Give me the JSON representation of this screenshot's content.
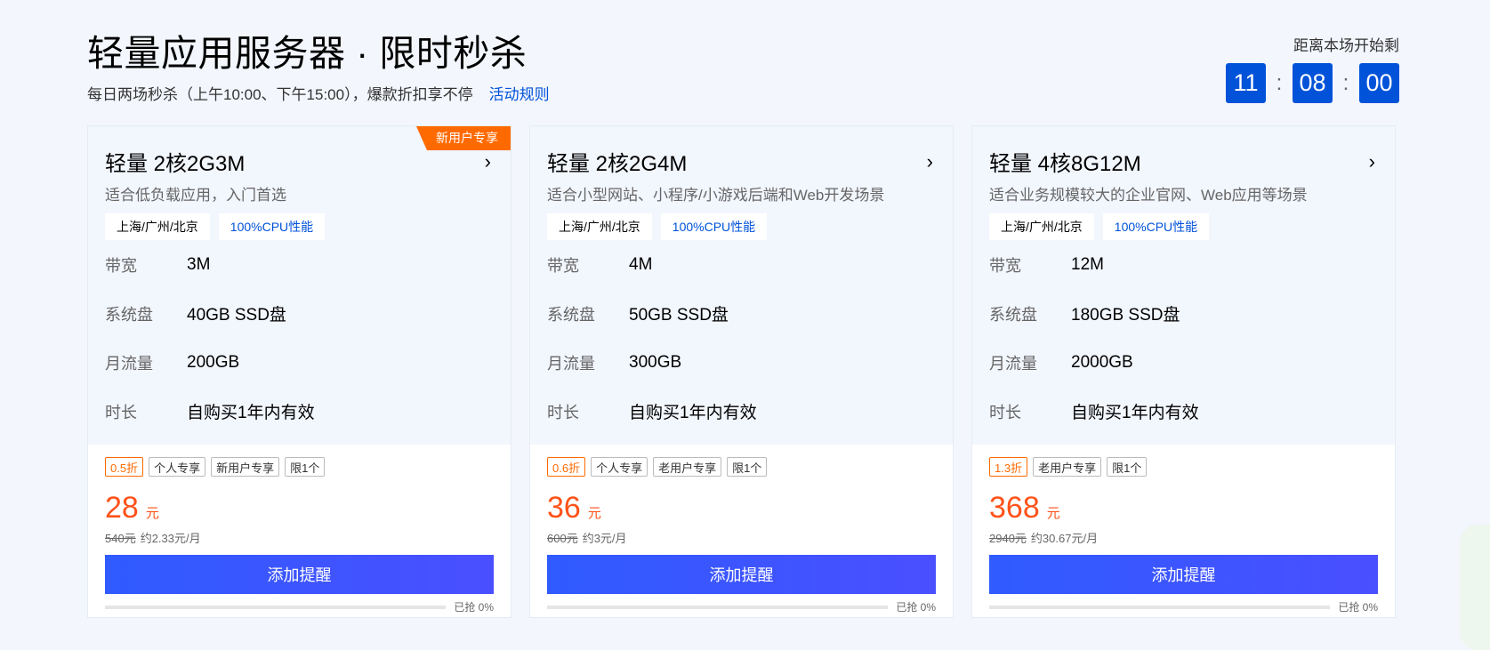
{
  "header": {
    "title": "轻量应用服务器 · 限时秒杀",
    "subtitle": "每日两场秒杀（上午10:00、下午15:00），爆款折扣享不停",
    "rules_link": "活动规则"
  },
  "countdown": {
    "label": "距离本场开始剩",
    "hours": "11",
    "minutes": "08",
    "seconds": "00",
    "separator": ":"
  },
  "cards": [
    {
      "ribbon": "新用户专享",
      "title": "轻量 2核2G3M",
      "chevron": "›",
      "desc": "适合低负载应用，入门首选",
      "tags": [
        "上海/广州/北京",
        "100%CPU性能"
      ],
      "specs": [
        {
          "label": "带宽",
          "value": "3M"
        },
        {
          "label": "系统盘",
          "value": "40GB SSD盘"
        },
        {
          "label": "月流量",
          "value": "200GB"
        },
        {
          "label": "时长",
          "value": "自购买1年内有效"
        }
      ],
      "badges": [
        "0.5折",
        "个人专享",
        "新用户专享",
        "限1个"
      ],
      "price": "28",
      "unit": "元",
      "original": "540元",
      "monthly": "约2.33元/月",
      "button": "添加提醒",
      "progress_fraction": 0,
      "progress_text": "已抢 0%"
    },
    {
      "ribbon": "",
      "title": "轻量 2核2G4M",
      "chevron": "›",
      "desc": "适合小型网站、小程序/小游戏后端和Web开发场景",
      "tags": [
        "上海/广州/北京",
        "100%CPU性能"
      ],
      "specs": [
        {
          "label": "带宽",
          "value": "4M"
        },
        {
          "label": "系统盘",
          "value": "50GB SSD盘"
        },
        {
          "label": "月流量",
          "value": "300GB"
        },
        {
          "label": "时长",
          "value": "自购买1年内有效"
        }
      ],
      "badges": [
        "0.6折",
        "个人专享",
        "老用户专享",
        "限1个"
      ],
      "price": "36",
      "unit": "元",
      "original": "600元",
      "monthly": "约3元/月",
      "button": "添加提醒",
      "progress_fraction": 0,
      "progress_text": "已抢 0%"
    },
    {
      "ribbon": "",
      "title": "轻量 4核8G12M",
      "chevron": "›",
      "desc": "适合业务规模较大的企业官网、Web应用等场景",
      "tags": [
        "上海/广州/北京",
        "100%CPU性能"
      ],
      "specs": [
        {
          "label": "带宽",
          "value": "12M"
        },
        {
          "label": "系统盘",
          "value": "180GB SSD盘"
        },
        {
          "label": "月流量",
          "value": "2000GB"
        },
        {
          "label": "时长",
          "value": "自购买1年内有效"
        }
      ],
      "badges": [
        "1.3折",
        "老用户专享",
        "限1个"
      ],
      "price": "368",
      "unit": "元",
      "original": "2940元",
      "monthly": "约30.67元/月",
      "button": "添加提醒",
      "progress_fraction": 0,
      "progress_text": "已抢 0%"
    }
  ],
  "colors": {
    "accent": "#0052d9",
    "price": "#ff5219",
    "ribbon": "#ff6a00"
  }
}
